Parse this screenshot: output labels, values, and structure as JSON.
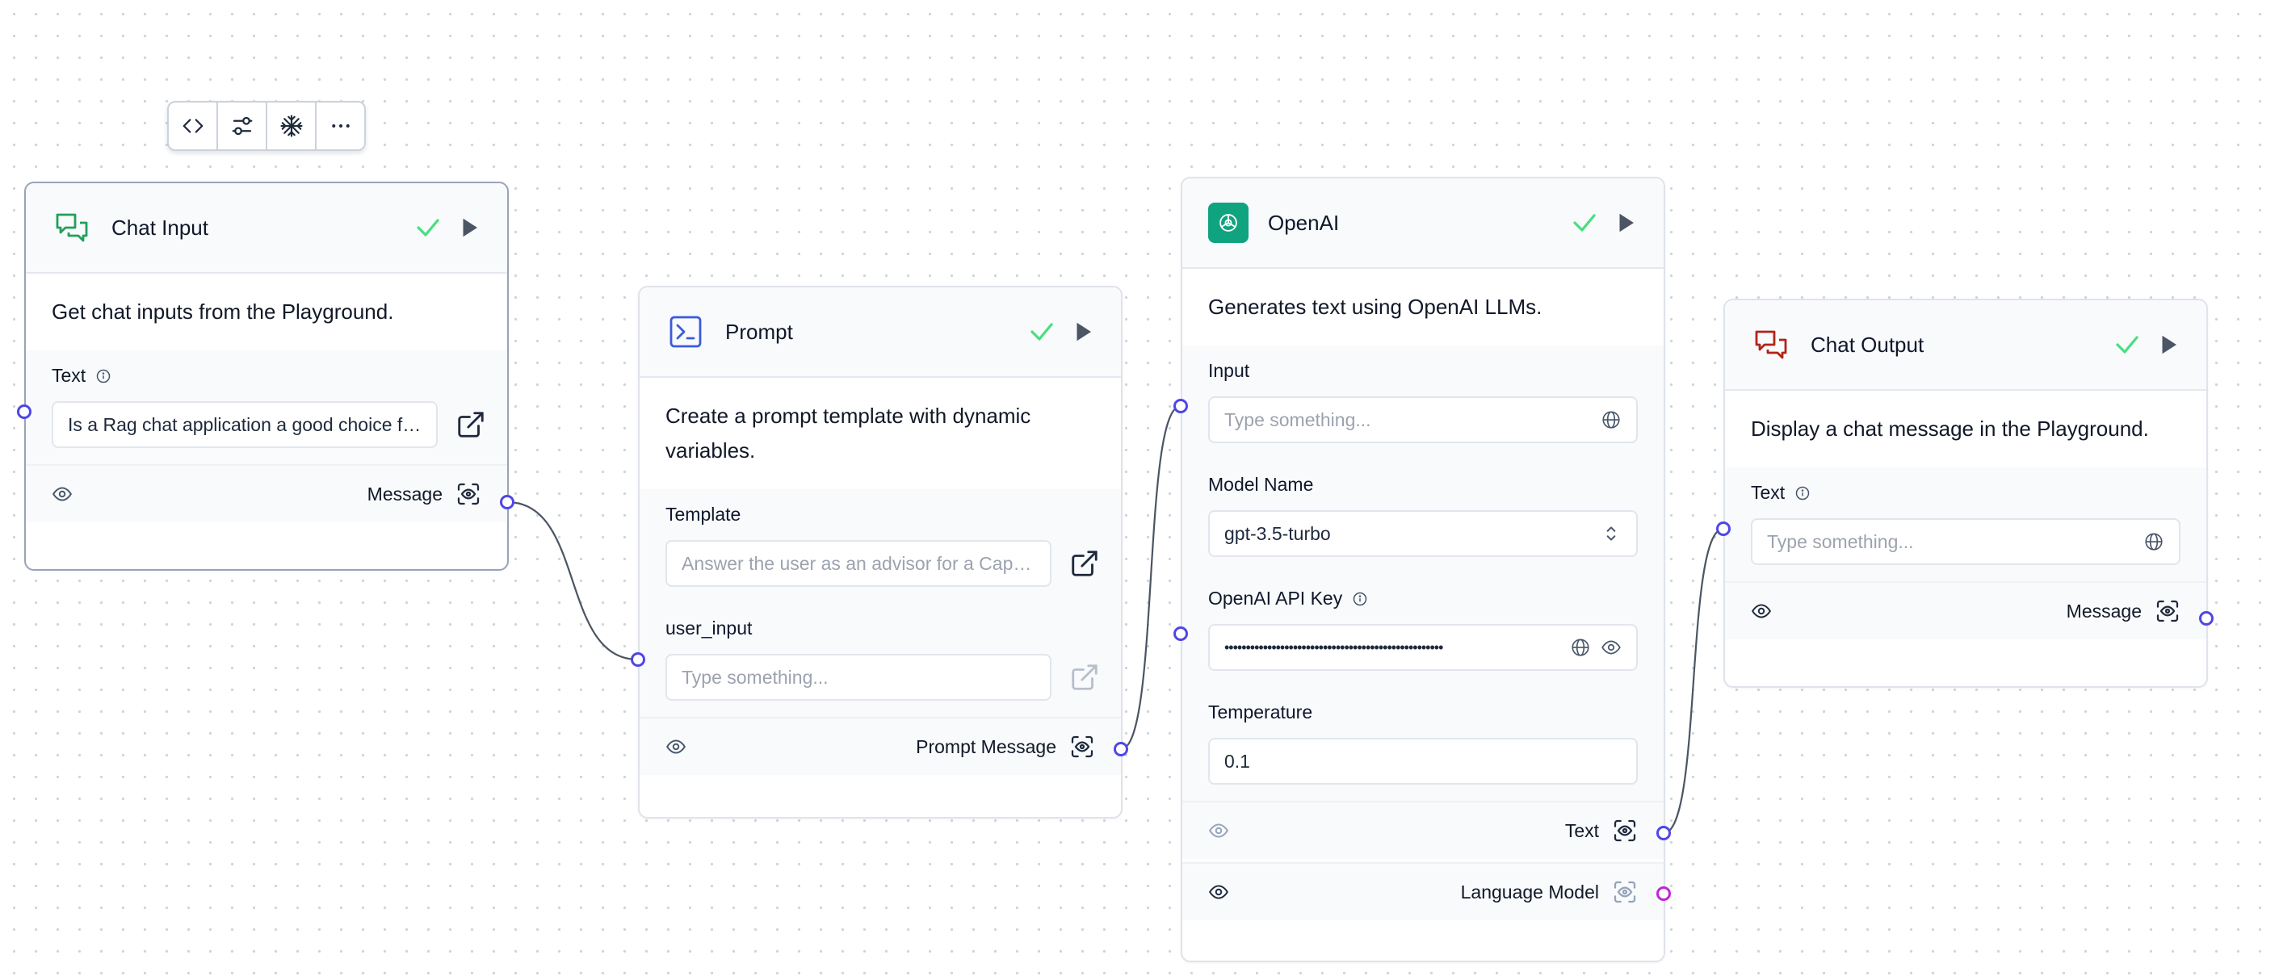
{
  "toolbar": {
    "buttons": [
      {
        "icon": "code-icon"
      },
      {
        "icon": "sliders-icon"
      },
      {
        "icon": "snowflake-icon"
      },
      {
        "icon": "more-icon"
      }
    ]
  },
  "colors": {
    "handle": "#4f46e5",
    "handle_model": "#c026d3",
    "check": "#4ade80",
    "chat_input_icon": "#22a05a",
    "prompt_icon": "#3b5bdb",
    "openai_icon_bg": "#10a37f",
    "chat_output_icon": "#b42318",
    "edge": "#4b5563"
  },
  "nodes": {
    "chat_input": {
      "title": "Chat Input",
      "description": "Get chat inputs from the Playground.",
      "field_label": "Text",
      "field_value": "Is a Rag chat application a good choice fo...",
      "output_label": "Message"
    },
    "prompt": {
      "title": "Prompt",
      "description": "Create a prompt template with dynamic variables.",
      "template_label": "Template",
      "template_value": "Answer the user as an advisor for a Capst...",
      "user_input_label": "user_input",
      "user_input_placeholder": "Type something...",
      "output_label": "Prompt Message"
    },
    "openai": {
      "title": "OpenAI",
      "description": "Generates text using OpenAI LLMs.",
      "input_label": "Input",
      "input_placeholder": "Type something...",
      "model_label": "Model Name",
      "model_value": "gpt-3.5-turbo",
      "api_key_label": "OpenAI API Key",
      "api_key_value": "•••••••••••••••••••••••••••••••••••••••••••••••••••",
      "temperature_label": "Temperature",
      "temperature_value": "0.1",
      "output_text_label": "Text",
      "output_model_label": "Language Model"
    },
    "chat_output": {
      "title": "Chat Output",
      "description": "Display a chat message in the Playground.",
      "field_label": "Text",
      "field_placeholder": "Type something...",
      "output_label": "Message"
    }
  }
}
